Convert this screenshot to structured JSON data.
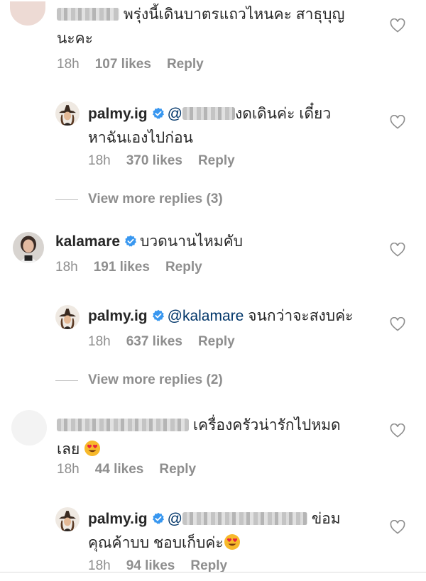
{
  "comments": [
    {
      "text": "พรุ่งนี้เดินบาตรแถวไหนคะ สาธุบุญ",
      "text_line2": "นะคะ",
      "time": "18h",
      "likes": "107 likes",
      "reply": "Reply"
    },
    {
      "username": "palmy.ig",
      "mention": "@",
      "text": "งดเดินค่ะ เดี๋ยว",
      "text_line2": "หาฉันเองไปก่อน",
      "time": "18h",
      "likes": "370 likes",
      "reply": "Reply"
    },
    {
      "view_more": "View more replies (3)"
    },
    {
      "username": "kalamare",
      "text": "บวดนานไหมคับ",
      "time": "18h",
      "likes": "191 likes",
      "reply": "Reply"
    },
    {
      "username": "palmy.ig",
      "mention": "@kalamare",
      "text": " จนกว่าจะสงบค่ะ",
      "time": "18h",
      "likes": "637 likes",
      "reply": "Reply"
    },
    {
      "view_more": "View more replies (2)"
    },
    {
      "text": "เครื่องครัวน่ารักไปหมด",
      "text_line2": "เลย",
      "time": "18h",
      "likes": "44 likes",
      "reply": "Reply"
    },
    {
      "username": "palmy.ig",
      "mention": "@",
      "text": "ข่อม",
      "text_line2": "คุณค้าบบ ชอบเก็บค่ะ",
      "time": "18h",
      "likes": "94 likes",
      "reply": "Reply"
    }
  ],
  "icons": {
    "verified": "verified-badge-icon",
    "like": "heart-outline-icon",
    "emoji": "heart-eyes-emoji"
  },
  "colors": {
    "verified": "#3897f0",
    "meta": "#8e8e8e",
    "text": "#262626"
  }
}
